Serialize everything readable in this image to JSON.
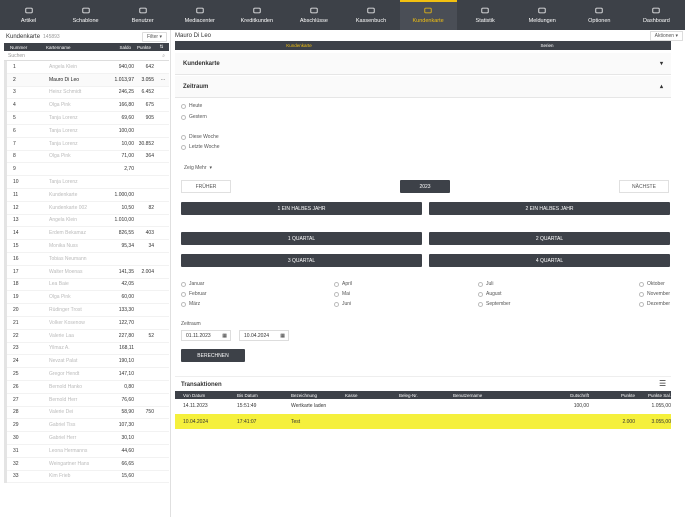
{
  "nav": [
    {
      "label": "Artikel",
      "icon": "article-icon"
    },
    {
      "label": "Schablone",
      "icon": "template-icon"
    },
    {
      "label": "Benutzer",
      "icon": "users-icon"
    },
    {
      "label": "Mediacenter",
      "icon": "media-icon"
    },
    {
      "label": "Kreditkunden",
      "icon": "credit-customers-icon"
    },
    {
      "label": "Abschlüsse",
      "icon": "closings-icon"
    },
    {
      "label": "Kassenbuch",
      "icon": "cashbook-icon"
    },
    {
      "label": "Kundenkarte",
      "icon": "customer-card-icon"
    },
    {
      "label": "Statistik",
      "icon": "statistics-icon"
    },
    {
      "label": "Meldungen",
      "icon": "messages-icon"
    },
    {
      "label": "Optionen",
      "icon": "options-icon"
    },
    {
      "label": "Dashboard",
      "icon": "dashboard-icon"
    }
  ],
  "left": {
    "title": "Kundenkarte",
    "count": "145893",
    "filter": "Filter",
    "columns": [
      "Nummer",
      "Kartenname",
      "Saldo",
      "Punkte"
    ],
    "search_placeholder": "Suchen",
    "rows": [
      [
        "1",
        "Angela Klein",
        "940,00",
        "642"
      ],
      [
        "2",
        "Mauro Di Leo",
        "1.013,97",
        "3.055"
      ],
      [
        "3",
        "Heinz Schmidt",
        "246,25",
        "6.452"
      ],
      [
        "4",
        "Olga Pink",
        "166,80",
        "675"
      ],
      [
        "5",
        "Tanja Lorenz",
        "69,60",
        "905"
      ],
      [
        "6",
        "Tanja Lorenz",
        "100,00",
        ""
      ],
      [
        "7",
        "Tanja Lorenz",
        "10,00",
        "30.852"
      ],
      [
        "8",
        "Olga Pink",
        "71,00",
        "364"
      ],
      [
        "9",
        "",
        "2,70",
        ""
      ],
      [
        "10",
        "Tanja Lorenz",
        "",
        ""
      ],
      [
        "11",
        "Kundenkarte",
        "1.000,00",
        ""
      ],
      [
        "12",
        "Kundenkarte 002",
        "10,50",
        "82"
      ],
      [
        "13",
        "Angela Klein",
        "1.010,00",
        ""
      ],
      [
        "14",
        "Erdem Bekamaz",
        "826,55",
        "403"
      ],
      [
        "15",
        "Monika Nuss",
        "95,34",
        "34"
      ],
      [
        "16",
        "Tobias Neumann",
        "",
        ""
      ],
      [
        "17",
        "Walter Moenas",
        "141,35",
        "2.004"
      ],
      [
        "18",
        "Lea Baie",
        "42,05",
        ""
      ],
      [
        "19",
        "Olga Pink",
        "60,00",
        ""
      ],
      [
        "20",
        "Rüdinger Trost",
        "133,30",
        ""
      ],
      [
        "21",
        "Volker Kosenow",
        "122,70",
        ""
      ],
      [
        "22",
        "Valerie Laa",
        "227,80",
        "52"
      ],
      [
        "23",
        "Yilmaz A.",
        "168,11",
        ""
      ],
      [
        "24",
        "Nevzat Palat",
        "190,10",
        ""
      ],
      [
        "25",
        "Gregor Hendt",
        "147,10",
        ""
      ],
      [
        "26",
        "Bernold Hanko",
        "0,80",
        ""
      ],
      [
        "27",
        "Bernold Herr",
        "76,60",
        ""
      ],
      [
        "28",
        "Valerie Dei",
        "58,90",
        "750"
      ],
      [
        "29",
        "Gabriel Tiss",
        "107,30",
        ""
      ],
      [
        "30",
        "Gabriel Herr",
        "30,10",
        ""
      ],
      [
        "31",
        "Leona Hermanns",
        "44,60",
        ""
      ],
      [
        "32",
        "Weingartner Hans",
        "66,65",
        ""
      ],
      [
        "33",
        "Kim Frieb",
        "15,60",
        ""
      ]
    ]
  },
  "main": {
    "customer": "Mauro Di Leo",
    "aktionen": "Aktionen",
    "tabs": [
      "Kundenkarte",
      "Serien"
    ],
    "section_card": "Kundenkarte",
    "section_zeitraum": "Zeitraum",
    "radios_a": [
      "Heute",
      "Gestern"
    ],
    "radios_b": [
      "Diese Woche",
      "Letzte Woche"
    ],
    "more": "Zeig Mehr",
    "prev": "FRÜHER",
    "year": "2023",
    "next": "NÄCHSTE",
    "half1": "1 EIN HALBES JAHR",
    "half2": "2 EIN HALBES JAHR",
    "q1": "1 QUARTAL",
    "q2": "2 QUARTAL",
    "q3": "3 QUARTAL",
    "q4": "4 QUARTAL",
    "months": [
      "Januar",
      "Februar",
      "März",
      "April",
      "Mai",
      "Juni",
      "Juli",
      "August",
      "September",
      "Oktober",
      "November",
      "Dezember"
    ],
    "zeitraum_label": "Zeitraum",
    "from": "01.11.2023",
    "to": "10.04.2024",
    "calc": "BERECHNEN",
    "transactions_title": "Transaktionen",
    "tcols": [
      "Von Datum",
      "Bis Datum",
      "Bezeichnung",
      "Kasse",
      "Beleg-Nr.",
      "Benutzername",
      "Gutschrift",
      "Punkte",
      "Punkte Sal."
    ],
    "trows": [
      [
        "14.11.2023",
        "15:51:49",
        "Wertkarte laden",
        "",
        "",
        "",
        "100,00",
        "",
        "1.055,00"
      ],
      [
        "10.04.2024",
        "17:41:07",
        "Test",
        "",
        "",
        "",
        "",
        "2.000",
        "3.055,00"
      ]
    ],
    "highlight": "#f5f03c"
  }
}
